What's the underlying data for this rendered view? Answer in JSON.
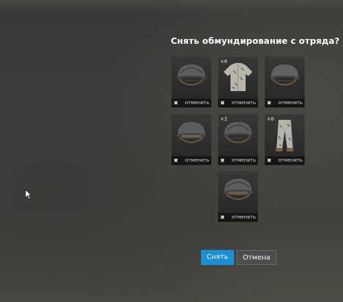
{
  "dialog": {
    "title": "Снять обмундирование с отряда?",
    "items": [
      {
        "type": "helmet",
        "count": "",
        "cancel_label": "отменить"
      },
      {
        "type": "shirt",
        "count": "×6",
        "cancel_label": "отменить"
      },
      {
        "type": "helmet",
        "count": "",
        "cancel_label": "отменить"
      },
      {
        "type": "helmet",
        "count": "",
        "cancel_label": "отменить"
      },
      {
        "type": "helmet",
        "count": "×2",
        "cancel_label": "отменить"
      },
      {
        "type": "pants",
        "count": "×6",
        "cancel_label": "отменить"
      },
      {
        "type": "helmet",
        "count": "",
        "cancel_label": "отменить"
      }
    ],
    "confirm_label": "Снять",
    "cancel_label": "Отмена"
  },
  "colors": {
    "primary_button": "#1a8fd6",
    "secondary_button": "#4b4d4e"
  },
  "icons": {
    "remove": "close-icon",
    "cursor": "mouse-cursor-icon"
  }
}
